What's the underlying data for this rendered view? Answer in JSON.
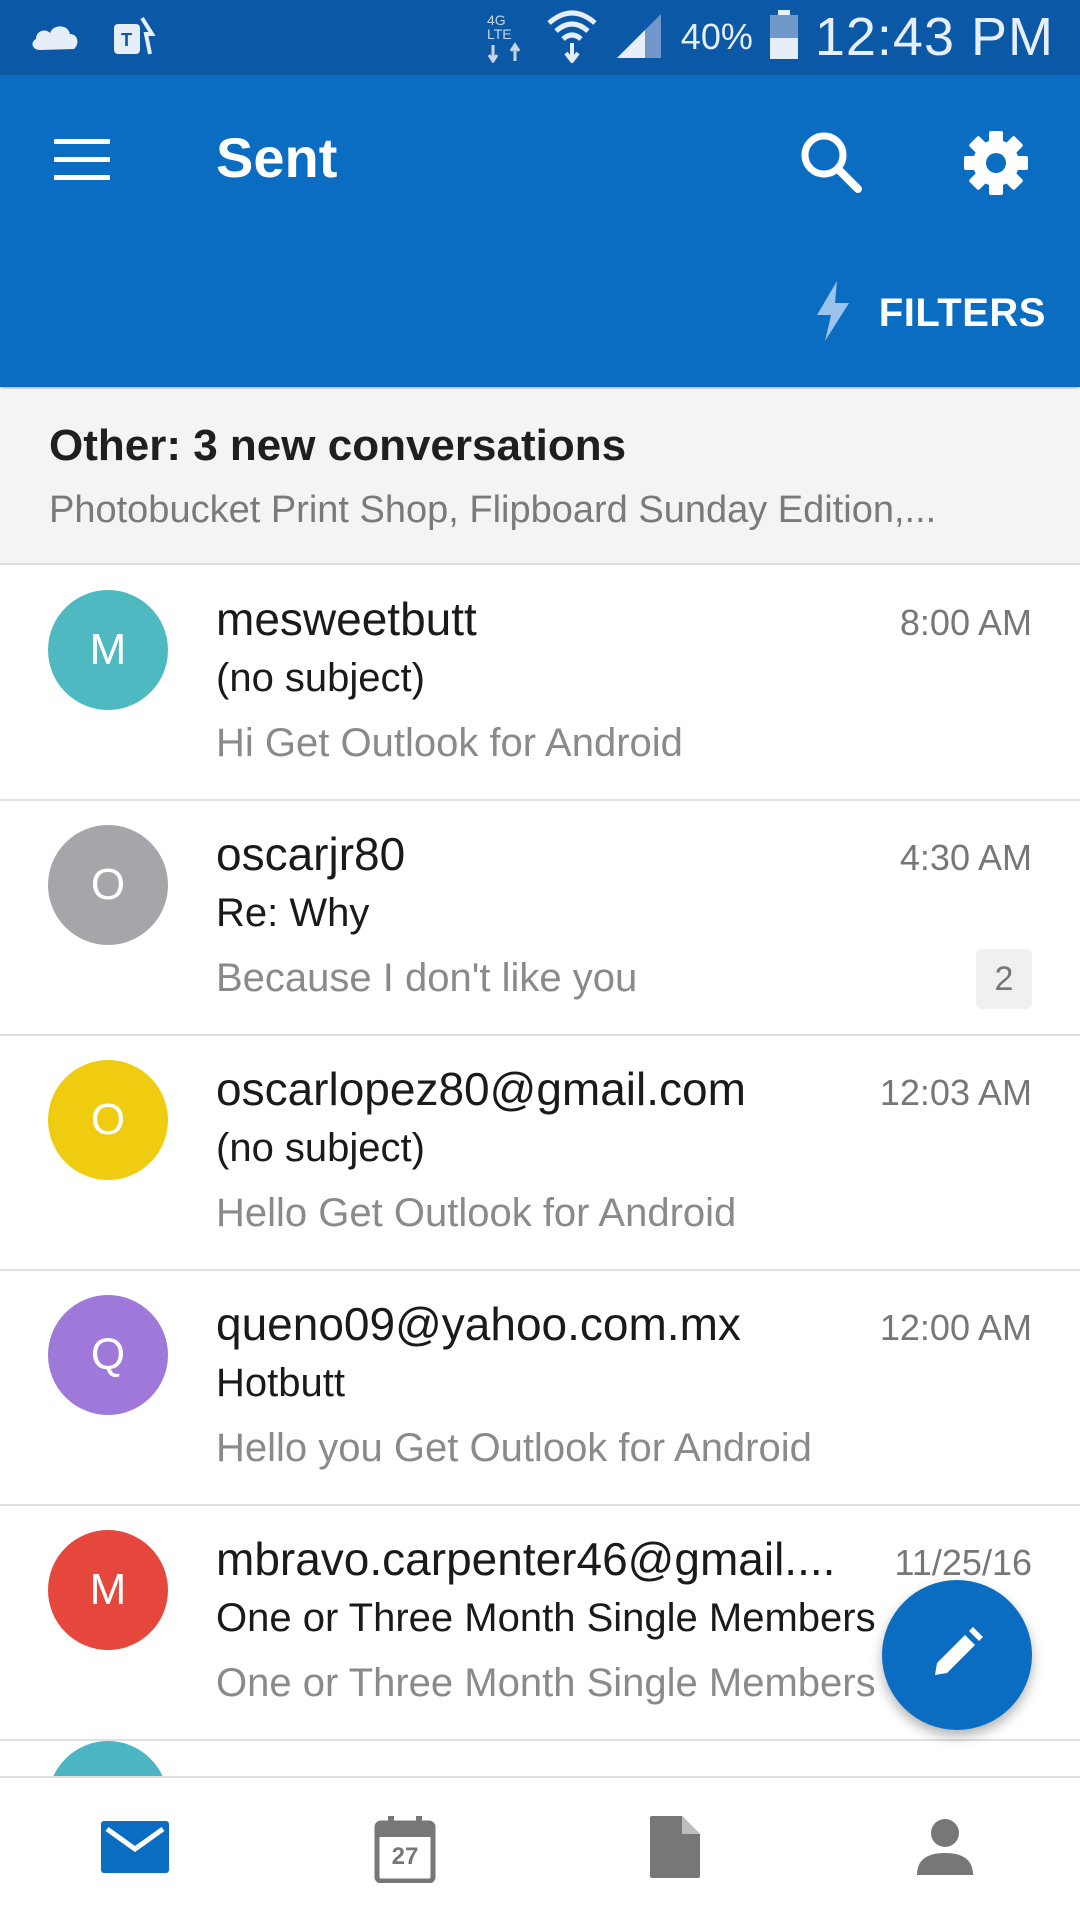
{
  "status_bar": {
    "battery_percent": "40%",
    "clock": "12:43 PM",
    "icons": [
      "cloud-icon",
      "t-mobile-icon",
      "lte-icon",
      "wifi-icon",
      "signal-icon",
      "battery-icon"
    ]
  },
  "app_bar": {
    "title": "Sent",
    "filters_label": "FILTERS",
    "icons": [
      "menu-icon",
      "search-icon",
      "gear-icon",
      "lightning-icon"
    ]
  },
  "other_banner": {
    "title": "Other: 3 new conversations",
    "subtitle": "Photobucket Print Shop, Flipboard Sunday Edition,..."
  },
  "messages": [
    {
      "initial": "M",
      "avatar_color": "#4fb9c2",
      "sender": "mesweetbutt",
      "time": "8:00 AM",
      "subject": "(no subject)",
      "preview": "Hi Get Outlook for Android",
      "count": ""
    },
    {
      "initial": "O",
      "avatar_color": "#a5a5aa",
      "sender": "oscarjr80",
      "time": "4:30 AM",
      "subject": "Re: Why",
      "preview": "Because I don't like you",
      "count": "2"
    },
    {
      "initial": "O",
      "avatar_color": "#efcc10",
      "sender": "oscarlopez80@gmail.com",
      "time": "12:03 AM",
      "subject": "(no subject)",
      "preview": "Hello Get Outlook for Android",
      "count": ""
    },
    {
      "initial": "Q",
      "avatar_color": "#9f79d9",
      "sender": "queno09@yahoo.com.mx",
      "time": "12:00 AM",
      "subject": "Hotbutt",
      "preview": "Hello you Get Outlook for Android",
      "count": ""
    },
    {
      "initial": "M",
      "avatar_color": "#e6473c",
      "sender": "mbravo.carpenter46@gmail....",
      "time": "11/25/16",
      "subject": "One or Three Month Single Members",
      "preview": "One or Three Month Single Members",
      "count": ""
    }
  ],
  "fab": {
    "icon": "pencil-icon"
  },
  "bottom_nav": {
    "items": [
      {
        "icon": "mail-icon",
        "active": true
      },
      {
        "icon": "calendar-icon",
        "calendar_day": "27",
        "active": false
      },
      {
        "icon": "file-icon",
        "active": false
      },
      {
        "icon": "person-icon",
        "active": false
      }
    ]
  },
  "colors": {
    "status_bar": "#0a58a6",
    "app_bar": "#0a6dc2",
    "nav_active": "#0a6dc2",
    "nav_inactive": "#777777"
  }
}
